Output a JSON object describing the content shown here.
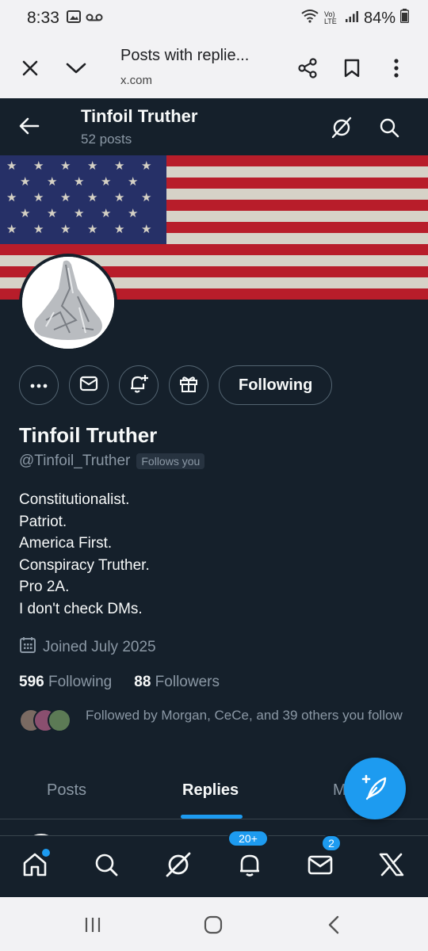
{
  "status_bar": {
    "time": "8:33",
    "battery": "84%",
    "network": "Vo) LTE"
  },
  "browser": {
    "title": "Posts with replie...",
    "url": "x.com"
  },
  "profile": {
    "header_name": "Tinfoil Truther",
    "posts_count": "52 posts",
    "name": "Tinfoil Truther",
    "handle": "@Tinfoil_Truther",
    "follows_you": "Follows you",
    "follow_button": "Following",
    "bio": [
      "Constitutionalist.",
      "Patriot.",
      "America First.",
      "Conspiracy Truther.",
      "Pro 2A.",
      "I don't check DMs."
    ],
    "joined": "Joined July 2025",
    "following_count": "596",
    "following_label": "Following",
    "followers_count": "88",
    "followers_label": "Followers",
    "followed_by": "Followed by Morgan, CeCe, and 39 others you follow"
  },
  "tabs": [
    {
      "label": "Posts",
      "active": false
    },
    {
      "label": "Replies",
      "active": true
    },
    {
      "label": "M",
      "active": false
    }
  ],
  "nav": {
    "notifications_badge": "20+",
    "messages_badge": "2"
  },
  "colors": {
    "background": "#15202b",
    "accent": "#1d9bf0",
    "muted": "#8b98a5",
    "border": "#38444d"
  },
  "icons": [
    "close-icon",
    "chevron-down-icon",
    "share-icon",
    "bookmark-icon",
    "more-vertical-icon",
    "back-arrow-icon",
    "grok-icon",
    "search-icon",
    "more-horizontal-icon",
    "mail-icon",
    "bell-plus-icon",
    "gift-icon",
    "calendar-icon",
    "compose-icon",
    "home-icon",
    "bell-icon",
    "x-logo-icon"
  ]
}
